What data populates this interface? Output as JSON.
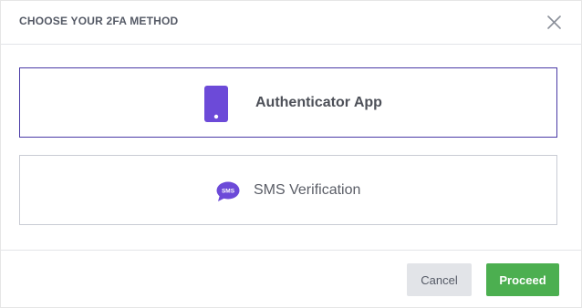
{
  "modal": {
    "title": "CHOOSE YOUR 2FA METHOD",
    "close_icon": "close-icon"
  },
  "options": [
    {
      "label": "Authenticator App",
      "icon": "smartphone-icon",
      "selected": true
    },
    {
      "label": "SMS Verification",
      "icon": "sms-bubble-icon",
      "icon_text": "SMS",
      "selected": false
    }
  ],
  "footer": {
    "cancel_label": "Cancel",
    "proceed_label": "Proceed"
  },
  "colors": {
    "accent": "#6c4ad8",
    "selected_border": "#4a3aa6",
    "proceed": "#4caf50",
    "cancel": "#e2e4e8"
  }
}
